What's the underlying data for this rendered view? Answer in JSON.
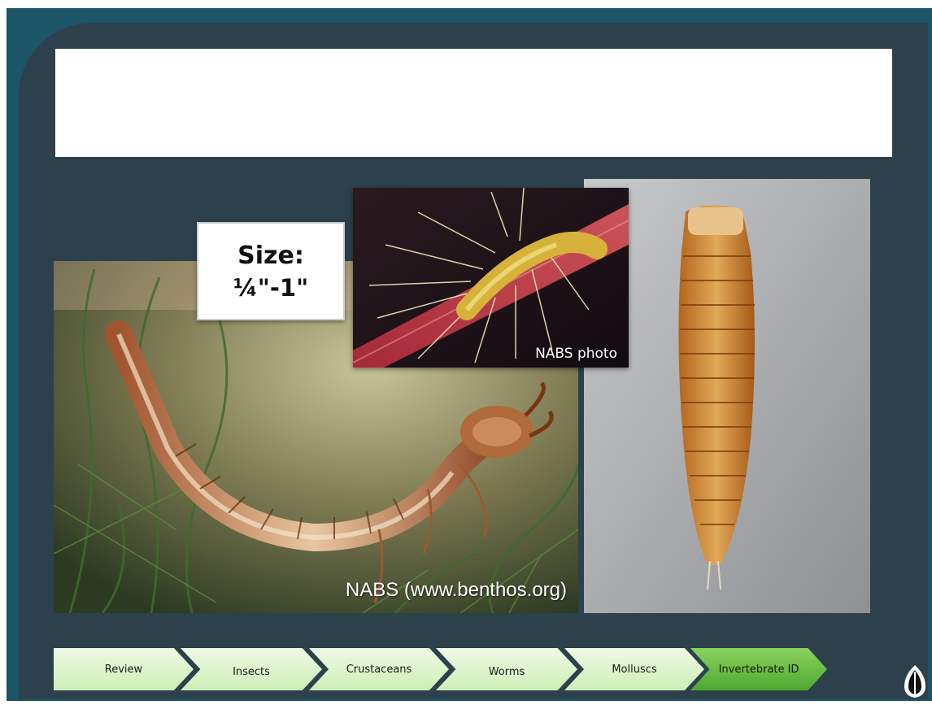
{
  "slide": {
    "title": "",
    "size_label": "Size:",
    "size_value": "¼\"-1\""
  },
  "photos": {
    "left_credit": "NABS (www.benthos.org)",
    "top_credit": "NABS photo"
  },
  "nav": {
    "items": [
      {
        "label": "Review"
      },
      {
        "label": "Insects"
      },
      {
        "label": "Crustaceans"
      },
      {
        "label": "Worms"
      },
      {
        "label": "Molluscs"
      },
      {
        "label": "Invertebrate ID",
        "active": true
      }
    ]
  },
  "colors": {
    "frame": "#1c5468",
    "slide": "#2d414c",
    "nav_inactive": "#cdeeb6",
    "nav_active": "#5cb83a"
  },
  "icons": {
    "logo": "leaf-logo-icon"
  }
}
